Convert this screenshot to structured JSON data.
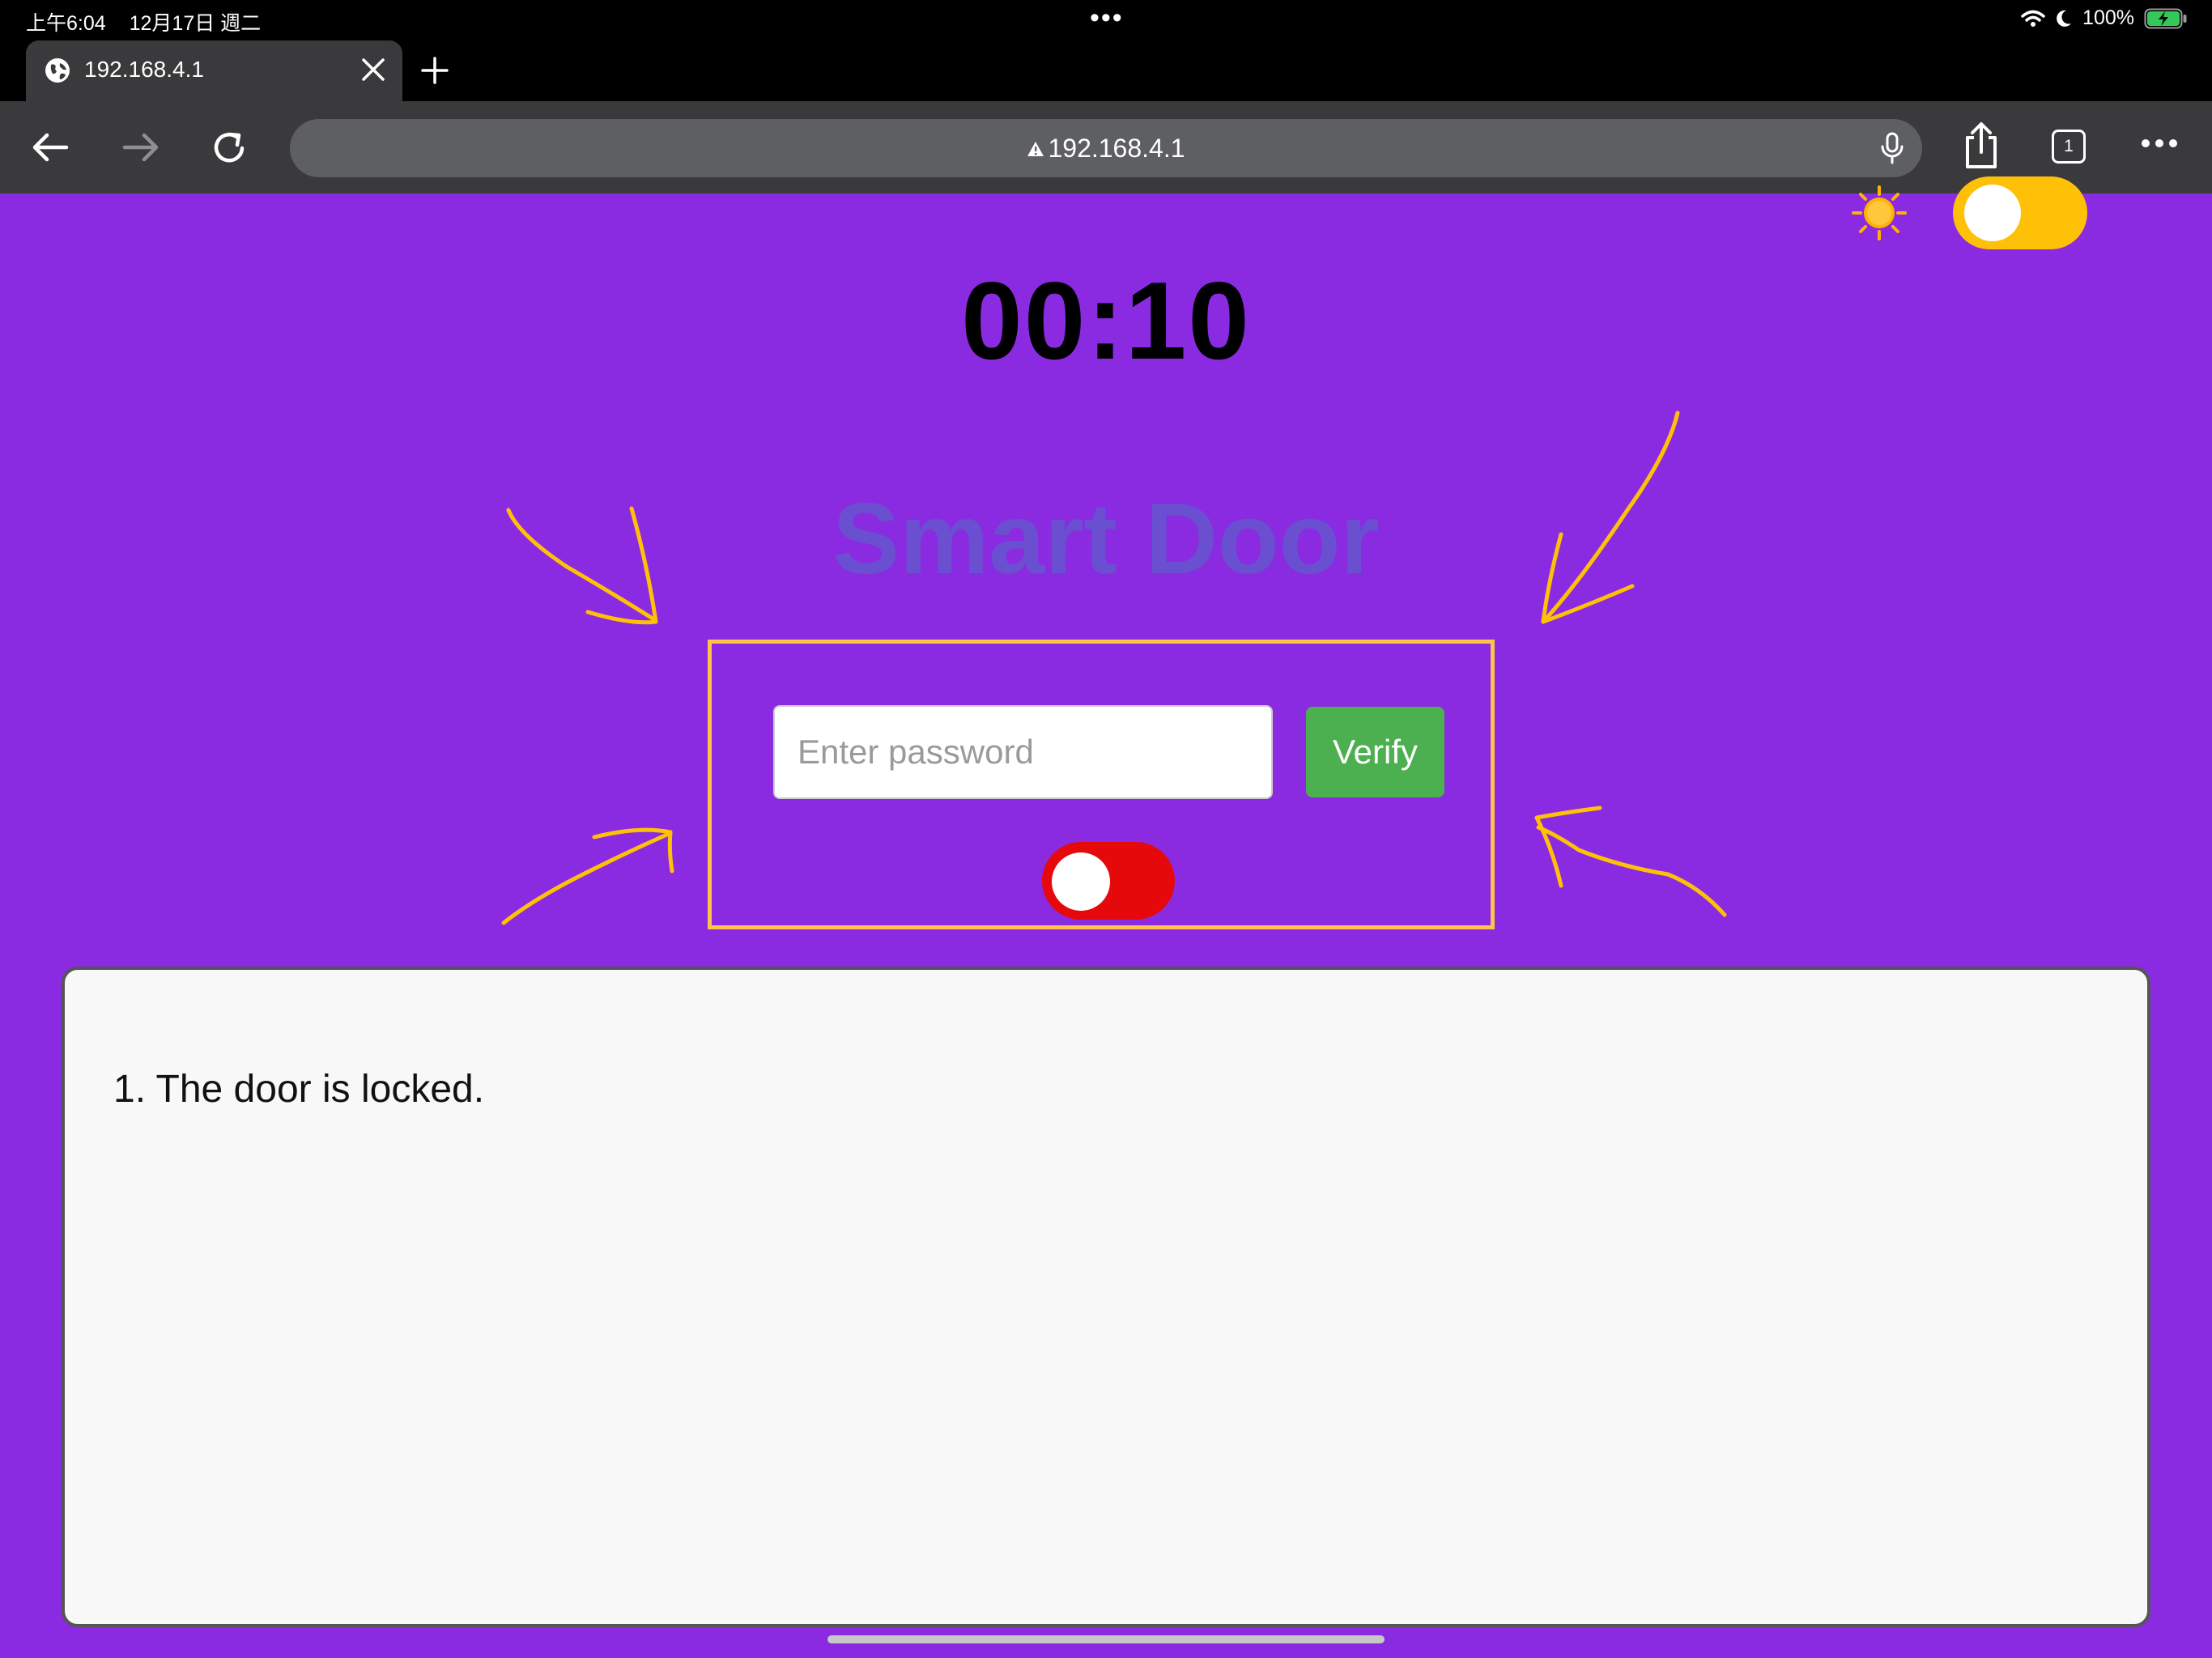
{
  "status_bar": {
    "time": "上午6:04",
    "date": "12月17日 週二",
    "battery": "100%"
  },
  "browser": {
    "tab_title": "192.168.4.1",
    "url": "192.168.4.1",
    "tab_count": "1"
  },
  "page": {
    "timer": "00:10",
    "title": "Smart Door",
    "password_placeholder": "Enter password",
    "verify_label": "Verify",
    "log_items": [
      "1. The door is locked."
    ]
  },
  "theme_toggle": {
    "state": "light",
    "sun_icon": "sun-icon",
    "moon_icon": "moon-icon"
  },
  "lock_toggle": {
    "state": "locked"
  },
  "colors": {
    "page_bg": "#8a2be2",
    "title_color": "#6a4fd0",
    "accent_yellow": "#ffc107",
    "verify_green": "#4caf50",
    "lock_red": "#e6090b"
  }
}
